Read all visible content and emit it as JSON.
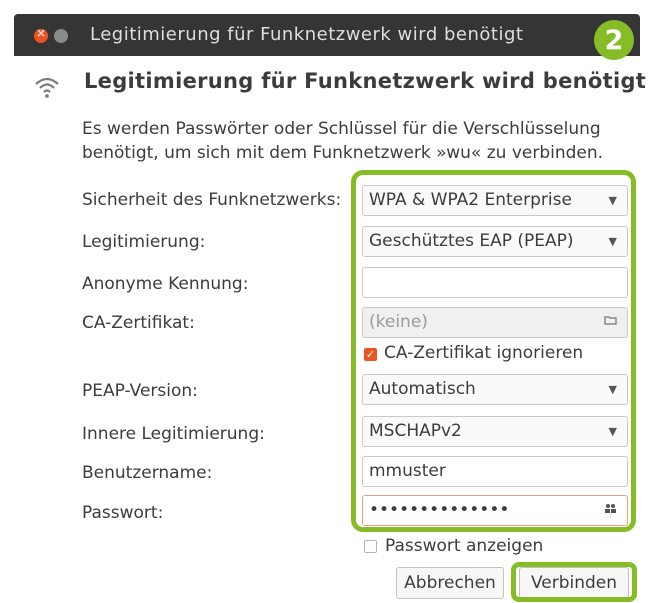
{
  "window": {
    "title": "Legitimierung für Funknetzwerk wird benötigt"
  },
  "badge": "2",
  "dialog": {
    "heading": "Legitimierung für Funknetzwerk wird benötigt",
    "description_line1": "Es werden Passwörter oder Schlüssel für die Verschlüsselung",
    "description_line2": "benötigt, um sich mit dem Funknetzwerk »wu« zu verbinden."
  },
  "form": {
    "security_label": "Sicherheit des Funknetzwerks:",
    "security_value": "WPA & WPA2 Enterprise",
    "auth_label": "Legitimierung:",
    "auth_value": "Geschütztes EAP (PEAP)",
    "anon_label": "Anonyme Kennung:",
    "anon_value": "",
    "ca_label": "CA-Zertifikat:",
    "ca_value": "(keine)",
    "ca_ignore_label": "CA-Zertifikat ignorieren",
    "ca_ignore_checked": true,
    "peap_label": "PEAP-Version:",
    "peap_value": "Automatisch",
    "inner_label": "Innere Legitimierung:",
    "inner_value": "MSCHAPv2",
    "user_label": "Benutzername:",
    "user_value": "mmuster",
    "pass_label": "Passwort:",
    "pass_value": "••••••••••••••",
    "show_pass_label": "Passwort anzeigen",
    "show_pass_checked": false
  },
  "buttons": {
    "cancel": "Abbrechen",
    "connect": "Verbinden"
  },
  "colors": {
    "accent": "#e95420",
    "highlight": "#86bc25",
    "titlebar": "#353535"
  }
}
